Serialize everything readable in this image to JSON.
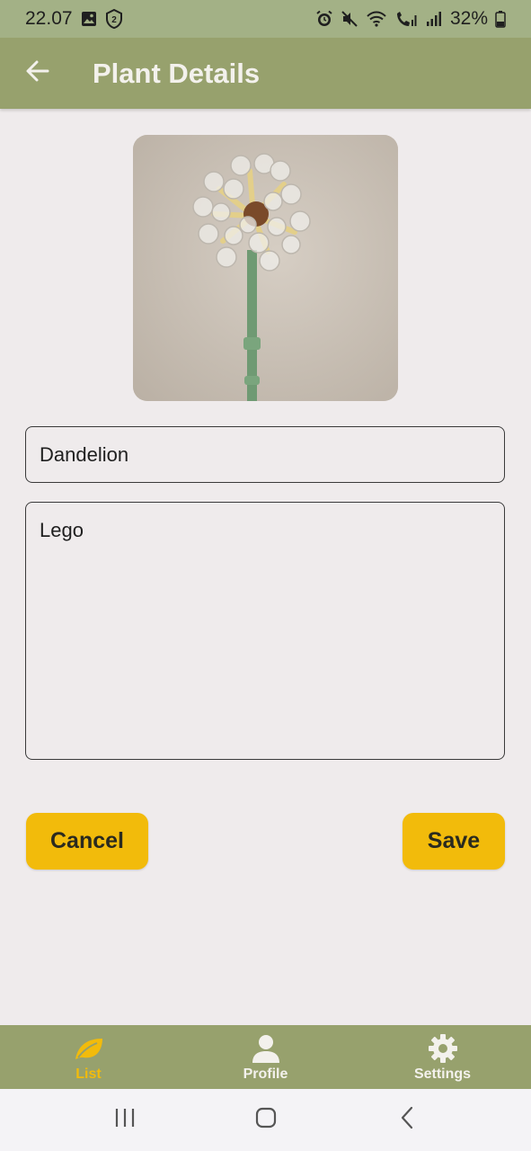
{
  "status_bar": {
    "time": "22.07",
    "battery": "32%",
    "icons_left": [
      "gallery-icon",
      "shield-badge-icon"
    ],
    "icons_right": [
      "alarm-icon",
      "mute-icon",
      "wifi-icon",
      "wifi-call-icon",
      "signal-icon",
      "signal-icon",
      "battery-icon"
    ]
  },
  "app_bar": {
    "title": "Plant Details",
    "back_icon": "arrow-left-icon"
  },
  "photo": {
    "subject": "lego-dandelion-photo"
  },
  "form": {
    "name_value": "Dandelion",
    "description_value": "Lego"
  },
  "actions": {
    "cancel_label": "Cancel",
    "save_label": "Save"
  },
  "bottom_nav": {
    "items": [
      {
        "label": "List",
        "icon": "leaf-icon",
        "active": true
      },
      {
        "label": "Profile",
        "icon": "person-icon",
        "active": false
      },
      {
        "label": "Settings",
        "icon": "gear-icon",
        "active": false
      }
    ]
  },
  "system_nav": {
    "icons": [
      "recent-apps-icon",
      "home-icon",
      "back-icon"
    ]
  },
  "colors": {
    "status_bar": "#a3b186",
    "app_bar": "#97a16d",
    "background": "#efebec",
    "accent": "#f2bb0b",
    "title_text": "#f3f1ec"
  }
}
